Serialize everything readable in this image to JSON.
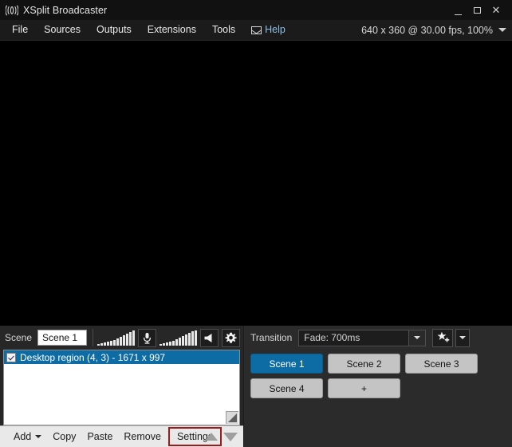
{
  "window": {
    "title": "XSplit Broadcaster",
    "app_icon": "broadcast-waves-icon",
    "controls": {
      "minimize": "minimize-icon",
      "maximize": "maximize-icon",
      "close": "✕"
    }
  },
  "menubar": {
    "items": [
      {
        "label": "File",
        "name": "menu-file"
      },
      {
        "label": "Sources",
        "name": "menu-sources"
      },
      {
        "label": "Outputs",
        "name": "menu-outputs"
      },
      {
        "label": "Extensions",
        "name": "menu-extensions"
      },
      {
        "label": "Tools",
        "name": "menu-tools"
      },
      {
        "label": "Help",
        "name": "menu-help",
        "icon": "mail-icon",
        "accent": "#8fbfe6"
      }
    ],
    "resolution_info": "640 x 360 @ 30.00 fps, 100%",
    "resolution_caret": "chevron-down-icon"
  },
  "preview": {
    "background": "#000000"
  },
  "scene_panel": {
    "scene_label": "Scene",
    "scene_name": "Scene 1",
    "mic_icon": "microphone-icon",
    "speaker_icon": "speaker-icon",
    "gear_icon": "gear-icon",
    "mic_meter_levels": [
      2,
      3,
      4,
      5,
      6,
      7,
      9,
      11,
      13,
      15,
      17,
      19
    ],
    "speaker_meter_levels": [
      2,
      3,
      4,
      5,
      6,
      8,
      10,
      12,
      14,
      16,
      18,
      19
    ],
    "sources": [
      {
        "label": "Desktop region (4, 3) - 1671 x 997",
        "checked": true,
        "selected": true
      }
    ],
    "actions": [
      {
        "label": "Add",
        "name": "add-button",
        "caret": true,
        "highlighted": false
      },
      {
        "label": "Copy",
        "name": "copy-button",
        "caret": false,
        "highlighted": false
      },
      {
        "label": "Paste",
        "name": "paste-button",
        "caret": false,
        "highlighted": false
      },
      {
        "label": "Remove",
        "name": "remove-button",
        "caret": false,
        "highlighted": false
      },
      {
        "label": "Settings",
        "name": "settings-button",
        "caret": false,
        "highlighted": true
      }
    ],
    "highlight_color": "#9e1b1b",
    "move_up_icon": "triangle-up-icon",
    "move_down_icon": "triangle-down-icon"
  },
  "transition_panel": {
    "transition_label": "Transition",
    "transition_value": "Fade: 700ms",
    "transition_caret": "chevron-down-icon",
    "star_icon": "add-favorite-star-icon",
    "star_caret": "chevron-down-icon",
    "scenes": [
      {
        "label": "Scene 1",
        "active": true
      },
      {
        "label": "Scene 2",
        "active": false
      },
      {
        "label": "Scene 3",
        "active": false
      },
      {
        "label": "Scene 4",
        "active": false
      },
      {
        "label": "+",
        "active": false
      }
    ],
    "accent_color": "#0e6ca5"
  }
}
